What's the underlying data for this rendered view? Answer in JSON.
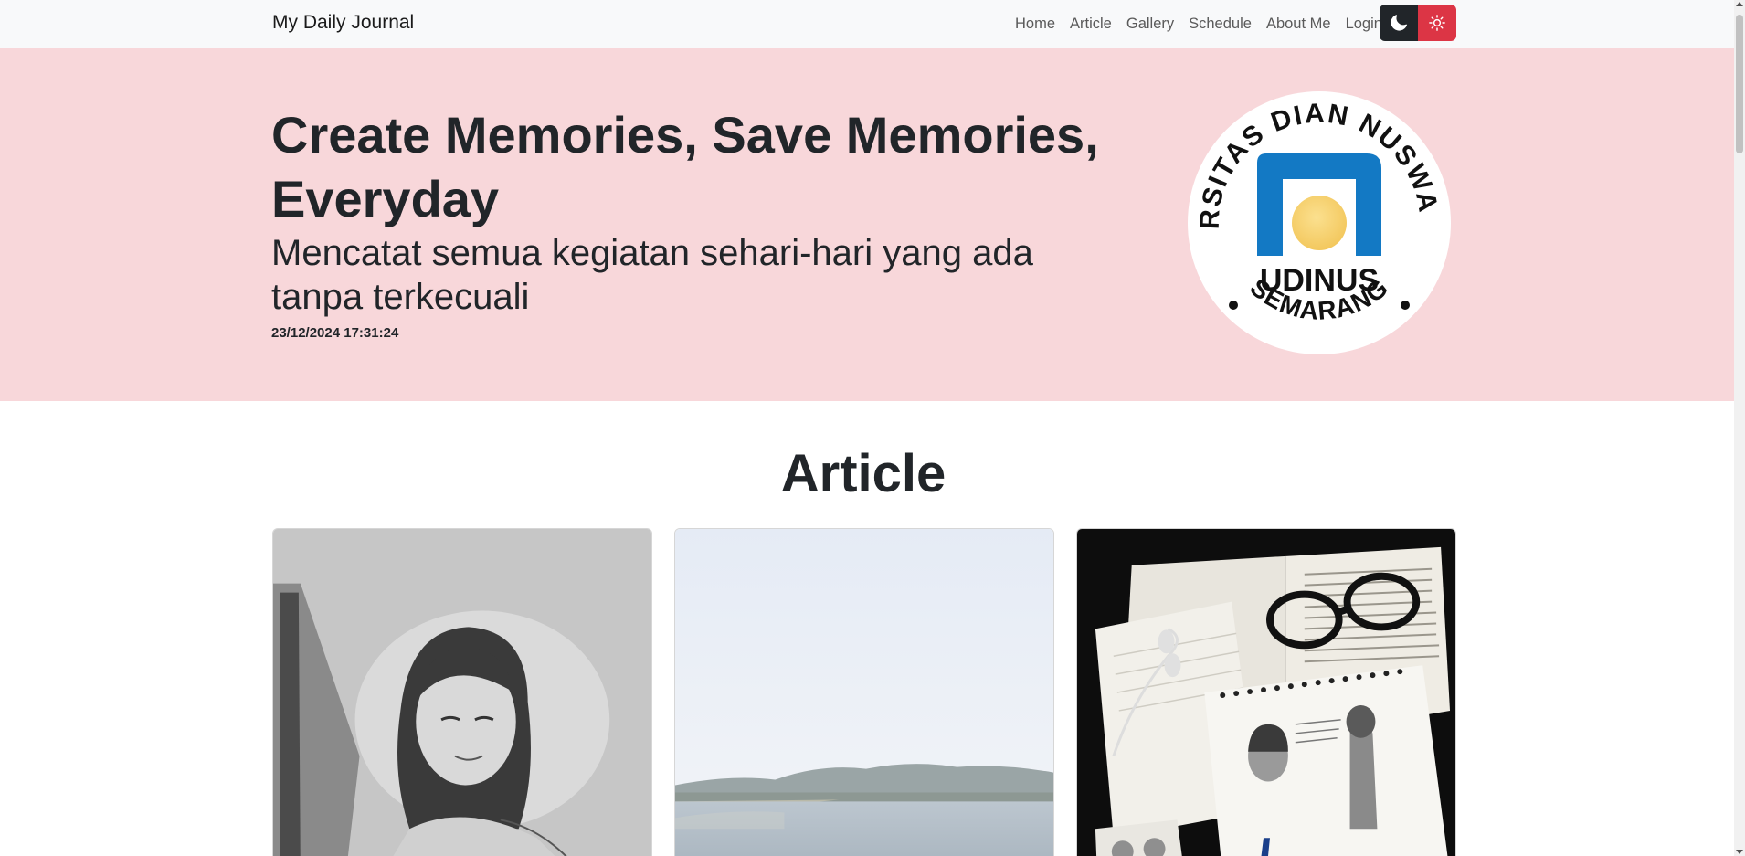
{
  "navbar": {
    "brand": "My Daily Journal",
    "links": [
      "Home",
      "Article",
      "Gallery",
      "Schedule",
      "About Me",
      "Login"
    ],
    "theme_buttons": {
      "dark_icon": "moon-icon",
      "light_icon": "sun-icon"
    }
  },
  "hero": {
    "title": "Create Memories, Save Memories, Everyday",
    "subtitle": "Mencatat semua kegiatan sehari-hari yang ada tanpa terkecuali",
    "datetime": "23/12/2024 17:31:24",
    "logo": {
      "ring_text": "UNIVERSITAS DIAN NUSWANTORO",
      "bottom_text": "SEMARANG",
      "center_text": "UDINUS"
    }
  },
  "article": {
    "heading": "Article",
    "cards": [
      {
        "image": "pencil-portrait-sketch"
      },
      {
        "image": "lake-landscape"
      },
      {
        "image": "journal-sketchbook-flatlay"
      }
    ]
  },
  "colors": {
    "hero_bg": "#f8d7da",
    "navbar_bg": "#f8f9fa",
    "dark_button": "#212529",
    "danger_button": "#dc3545",
    "logo_blue": "#1379c4",
    "logo_yellow": "#f8d27a"
  }
}
